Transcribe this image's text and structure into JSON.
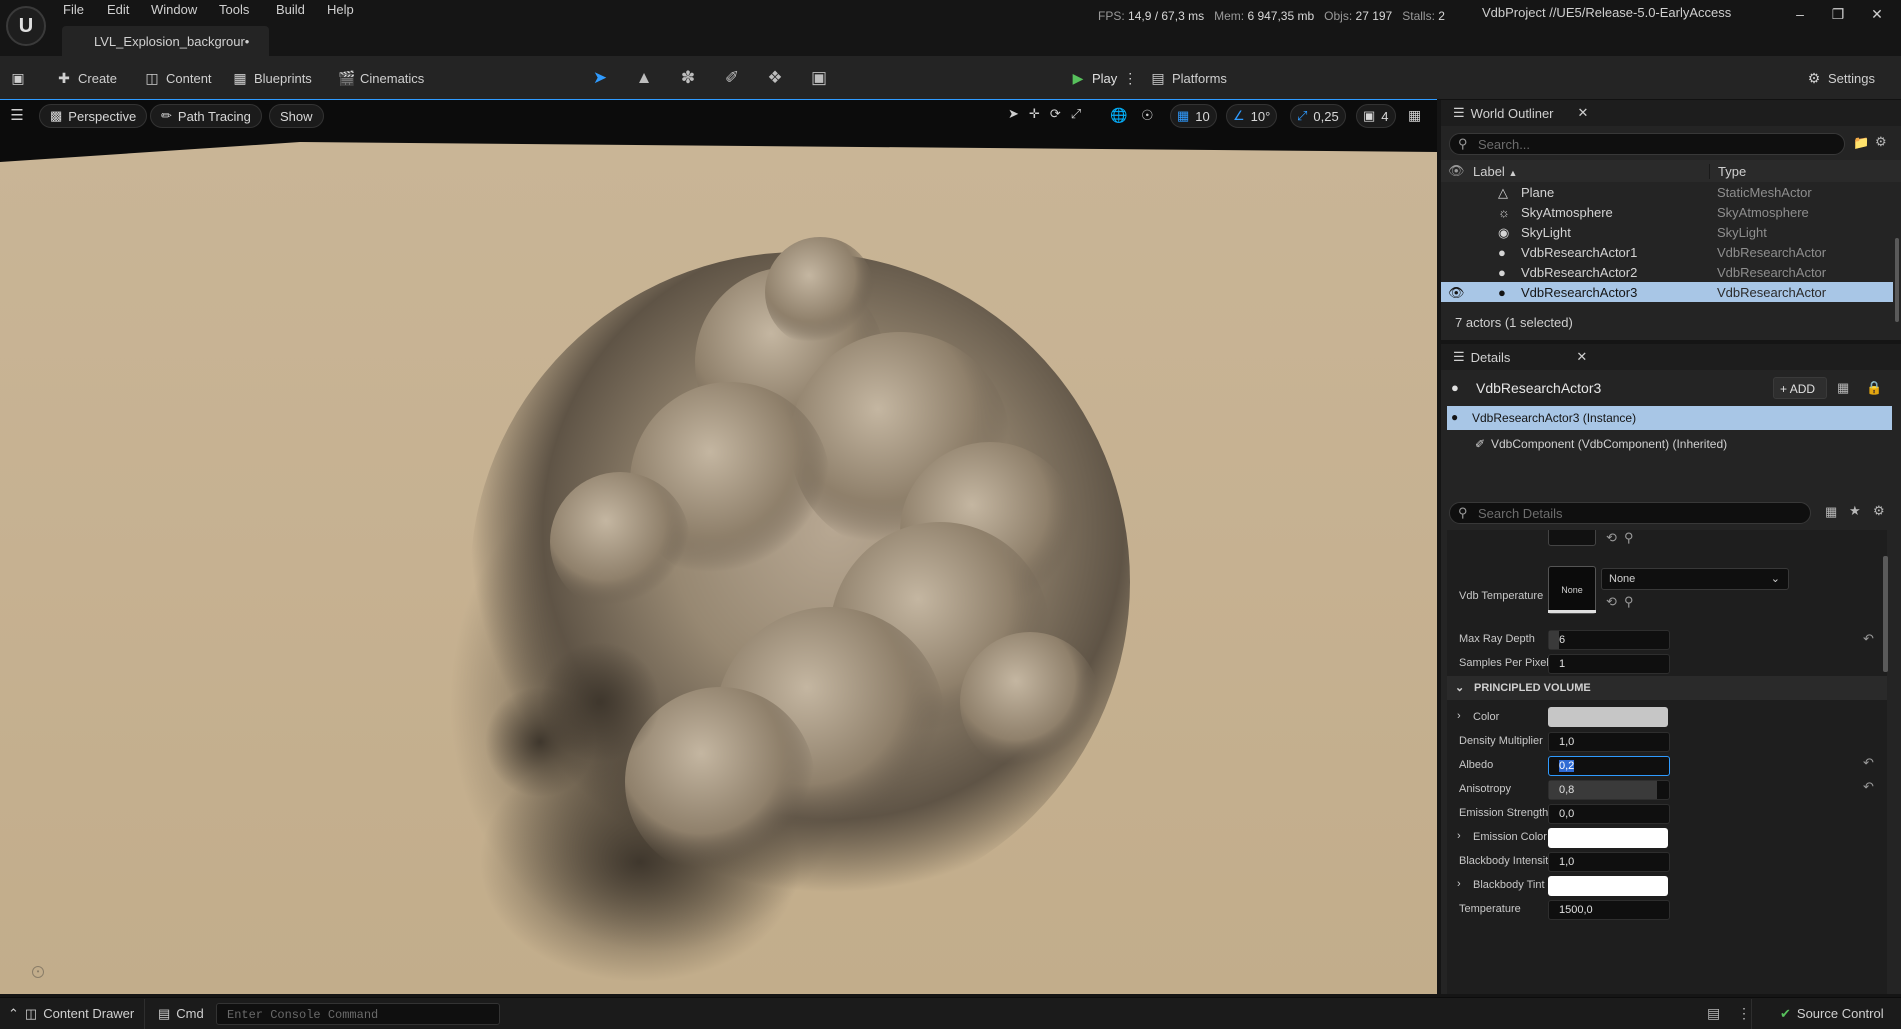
{
  "menu": [
    "File",
    "Edit",
    "Window",
    "Tools",
    "Build",
    "Help"
  ],
  "document_tab": "LVL_Explosion_backgrour•",
  "stats": {
    "fps_label": "FPS:",
    "fps": "14,9",
    "ms": "/ 67,3 ms",
    "mem_label": "Mem:",
    "mem": "6 947,35 mb",
    "objs_label": "Objs:",
    "objs": "27 197",
    "stalls_label": "Stalls:",
    "stalls": "2"
  },
  "project": "VdbProject //UE5/Release-5.0-EarlyAccess",
  "toolbar": {
    "create": "Create",
    "content": "Content",
    "blueprints": "Blueprints",
    "cinematics": "Cinematics",
    "play": "Play",
    "platforms": "Platforms",
    "settings": "Settings"
  },
  "viewport": {
    "perspective": "Perspective",
    "path_tracing": "Path Tracing",
    "show": "Show",
    "grid_snap": "10",
    "rot_snap": "10°",
    "scale_snap": "0,25",
    "cam_speed": "4"
  },
  "outliner": {
    "title": "World Outliner",
    "search_placeholder": "Search...",
    "col_label": "Label",
    "col_type": "Type",
    "rows": [
      {
        "label": "Plane",
        "type": "StaticMeshActor"
      },
      {
        "label": "SkyAtmosphere",
        "type": "SkyAtmosphere"
      },
      {
        "label": "SkyLight",
        "type": "SkyLight"
      },
      {
        "label": "VdbResearchActor1",
        "type": "VdbResearchActor"
      },
      {
        "label": "VdbResearchActor2",
        "type": "VdbResearchActor"
      },
      {
        "label": "VdbResearchActor3",
        "type": "VdbResearchActor"
      }
    ],
    "footer": "7 actors (1 selected)"
  },
  "details": {
    "title": "Details",
    "actor_name": "VdbResearchActor3",
    "add_label": "ADD",
    "instance": "VdbResearchActor3 (Instance)",
    "component": "VdbComponent (VdbComponent) (Inherited)",
    "search_placeholder": "Search Details",
    "vdb_temperature_label": "Vdb Temperature",
    "none_thumb": "None",
    "none_dropdown": "None",
    "max_ray_depth_label": "Max Ray Depth",
    "max_ray_depth": "6",
    "max_ray_depth_fill": 0.08,
    "samples_label": "Samples Per Pixel",
    "samples": "1",
    "section": "PRINCIPLED VOLUME",
    "color_label": "Color",
    "color_value": "#c6c6c6",
    "density_label": "Density Multiplier",
    "density": "1,0",
    "albedo_label": "Albedo",
    "albedo": "0,2",
    "anisotropy_label": "Anisotropy",
    "anisotropy": "0,8",
    "anisotropy_fill": 0.9,
    "emission_strength_label": "Emission Strength",
    "emission_strength": "0,0",
    "emission_color_label": "Emission Color",
    "emission_color": "#ffffff",
    "blackbody_intensity_label": "Blackbody Intensit",
    "blackbody_intensity": "1,0",
    "blackbody_tint_label": "Blackbody Tint",
    "blackbody_tint": "#ffffff",
    "temperature_label": "Temperature",
    "temperature": "1500,0"
  },
  "statusbar": {
    "content_drawer": "Content Drawer",
    "cmd": "Cmd",
    "console_placeholder": "Enter Console Command",
    "source_control": "Source Control"
  },
  "colors": {
    "accent_blue": "#2f9bff",
    "play_green": "#57c15c",
    "selection": "#a8c6e6",
    "wall": "#c6b191"
  }
}
